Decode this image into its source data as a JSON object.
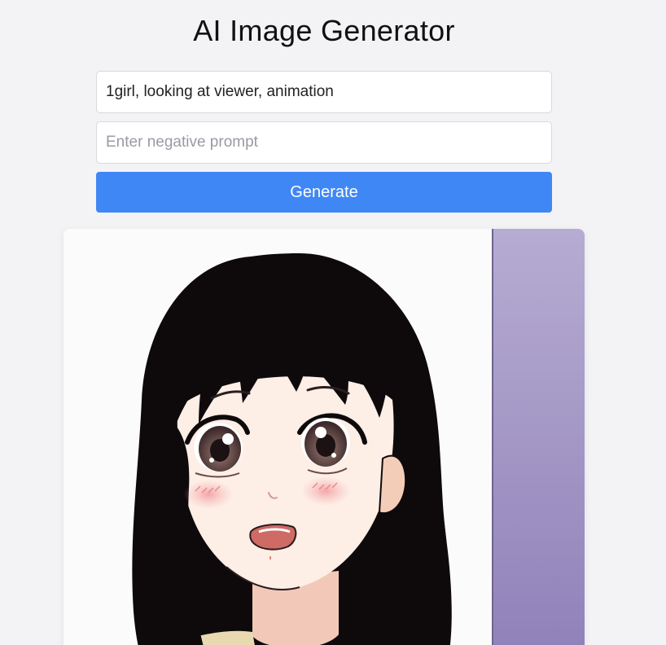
{
  "app": {
    "title": "AI Image Generator"
  },
  "form": {
    "prompt_value": "1girl, looking at viewer, animation",
    "negative_placeholder": "Enter negative prompt",
    "negative_value": "",
    "generate_label": "Generate"
  },
  "result": {
    "image_subject": "anime-girl-portrait",
    "colors": {
      "background": "#fafafa",
      "panel": "#a89cc8",
      "hair": "#0e0a0c",
      "skin": "#fbeee6",
      "blush": "#f2a3a8",
      "eye": "#5a3e3e",
      "mouth": "#c4615d",
      "button": "#3f87f5"
    }
  }
}
